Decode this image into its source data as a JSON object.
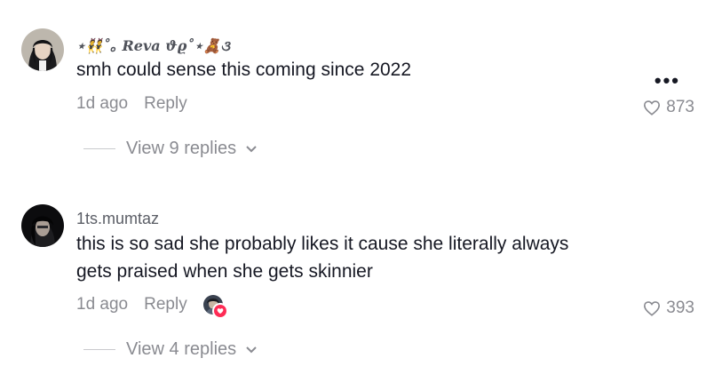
{
  "comments": [
    {
      "username": "⋆👯˚｡ Reva ϑϱ˚⋆🧸૩",
      "text": "smh could sense this coming since 2022",
      "time": "1d ago",
      "reply_label": "Reply",
      "likes": "873",
      "more_label": "•••",
      "view_replies": "View 9 replies"
    },
    {
      "username": "1ts.mumtaz",
      "text_lines": [
        "this is so sad she probably likes it cause she literally always",
        "gets praised when she gets skinnier"
      ],
      "time": "1d ago",
      "reply_label": "Reply",
      "likes": "393",
      "view_replies": "View 4 replies"
    }
  ],
  "colors": {
    "text": "#161823",
    "secondary": "#8a8b91",
    "accent": "#fe2c55"
  }
}
